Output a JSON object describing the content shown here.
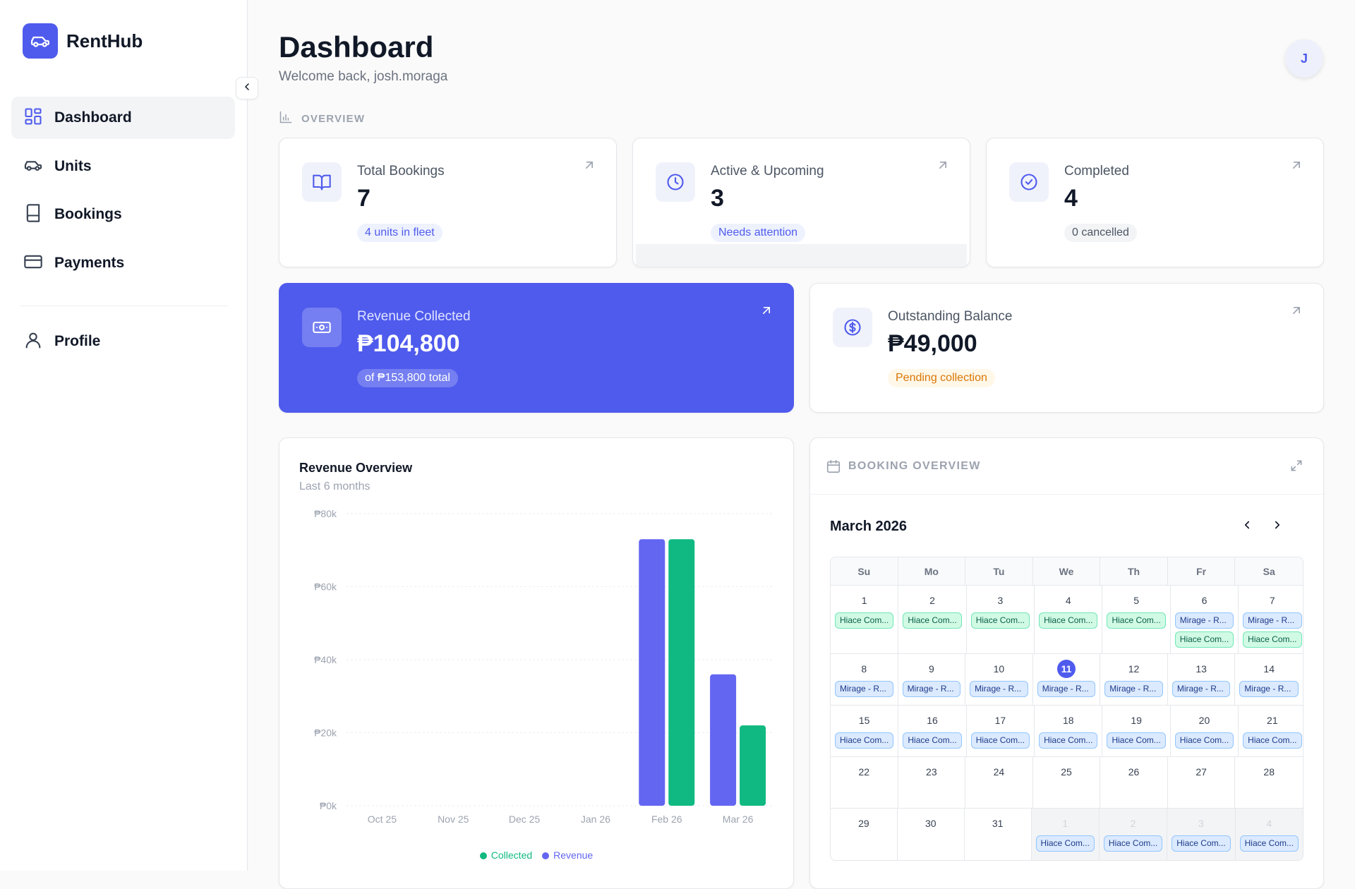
{
  "brand": {
    "name": "RentHub"
  },
  "sidebar": {
    "items": [
      {
        "label": "Dashboard",
        "icon": "dashboard-grid-icon",
        "active": true
      },
      {
        "label": "Units",
        "icon": "car-icon"
      },
      {
        "label": "Bookings",
        "icon": "book-icon"
      },
      {
        "label": "Payments",
        "icon": "credit-card-icon"
      },
      {
        "label": "Profile",
        "icon": "user-icon"
      }
    ]
  },
  "header": {
    "title": "Dashboard",
    "welcome": "Welcome back, josh.moraga",
    "avatar_initial": "J"
  },
  "overview": {
    "label": "OVERVIEW"
  },
  "stats": {
    "total_bookings": {
      "label": "Total Bookings",
      "value": "7",
      "badge": "4 units in fleet"
    },
    "active_upcoming": {
      "label": "Active & Upcoming",
      "value": "3",
      "badge": "Needs attention"
    },
    "completed": {
      "label": "Completed",
      "value": "4",
      "badge": "0 cancelled"
    },
    "revenue": {
      "label": "Revenue Collected",
      "value": "₱104,800",
      "badge": "of ₱153,800 total"
    },
    "outstanding": {
      "label": "Outstanding Balance",
      "value": "₱49,000",
      "badge": "Pending collection"
    }
  },
  "colors": {
    "accent": "#4f5bed",
    "revenue_bar": "#6366f1",
    "collected_bar": "#10b981",
    "warning": "#d97706"
  },
  "revenue_chart": {
    "title": "Revenue Overview",
    "subtitle": "Last 6 months"
  },
  "chart_data": {
    "type": "bar",
    "title": "Revenue Overview",
    "subtitle": "Last 6 months",
    "categories": [
      "Oct 25",
      "Nov 25",
      "Dec 25",
      "Jan 26",
      "Feb 26",
      "Mar 26"
    ],
    "series": [
      {
        "name": "Revenue",
        "color": "#6366f1",
        "values": [
          0,
          0,
          0,
          0,
          73000,
          36000
        ]
      },
      {
        "name": "Collected",
        "color": "#10b981",
        "values": [
          0,
          0,
          0,
          0,
          73000,
          22000
        ]
      }
    ],
    "ylim": [
      0,
      80000
    ],
    "yticks": [
      0,
      20000,
      40000,
      60000,
      80000
    ],
    "ytick_labels": [
      "₱0k",
      "₱20k",
      "₱40k",
      "₱60k",
      "₱80k"
    ],
    "legend": [
      {
        "label": "Collected",
        "color": "#10b981"
      },
      {
        "label": "Revenue",
        "color": "#6366f1"
      }
    ],
    "legend_position": "bottom",
    "grid": true
  },
  "calendar": {
    "section_label": "BOOKING OVERVIEW",
    "month": "March 2026",
    "weekdays": [
      "Su",
      "Mo",
      "Tu",
      "We",
      "Th",
      "Fr",
      "Sa"
    ],
    "weeks": [
      [
        {
          "day": "1",
          "events": [
            {
              "label": "Hiace Com...",
              "color": "green"
            }
          ]
        },
        {
          "day": "2",
          "events": [
            {
              "label": "Hiace Com...",
              "color": "green"
            }
          ]
        },
        {
          "day": "3",
          "events": [
            {
              "label": "Hiace Com...",
              "color": "green"
            }
          ]
        },
        {
          "day": "4",
          "events": [
            {
              "label": "Hiace Com...",
              "color": "green"
            }
          ]
        },
        {
          "day": "5",
          "events": [
            {
              "label": "Hiace Com...",
              "color": "green"
            }
          ]
        },
        {
          "day": "6",
          "events": [
            {
              "label": "Mirage - R...",
              "color": "blue"
            },
            {
              "label": "Hiace Com...",
              "color": "green"
            }
          ]
        },
        {
          "day": "7",
          "events": [
            {
              "label": "Mirage - R...",
              "color": "blue"
            },
            {
              "label": "Hiace Com...",
              "color": "green"
            }
          ]
        }
      ],
      [
        {
          "day": "8",
          "events": [
            {
              "label": "Mirage - R...",
              "color": "blue"
            }
          ]
        },
        {
          "day": "9",
          "events": [
            {
              "label": "Mirage - R...",
              "color": "blue"
            }
          ]
        },
        {
          "day": "10",
          "events": [
            {
              "label": "Mirage - R...",
              "color": "blue"
            }
          ]
        },
        {
          "day": "11",
          "today": true,
          "events": [
            {
              "label": "Mirage - R...",
              "color": "blue"
            }
          ]
        },
        {
          "day": "12",
          "events": [
            {
              "label": "Mirage - R...",
              "color": "blue"
            }
          ]
        },
        {
          "day": "13",
          "events": [
            {
              "label": "Mirage - R...",
              "color": "blue"
            }
          ]
        },
        {
          "day": "14",
          "events": [
            {
              "label": "Mirage - R...",
              "color": "blue"
            }
          ]
        }
      ],
      [
        {
          "day": "15",
          "events": [
            {
              "label": "Hiace Com...",
              "color": "blue"
            }
          ]
        },
        {
          "day": "16",
          "events": [
            {
              "label": "Hiace Com...",
              "color": "blue"
            }
          ]
        },
        {
          "day": "17",
          "events": [
            {
              "label": "Hiace Com...",
              "color": "blue"
            }
          ]
        },
        {
          "day": "18",
          "events": [
            {
              "label": "Hiace Com...",
              "color": "blue"
            }
          ]
        },
        {
          "day": "19",
          "events": [
            {
              "label": "Hiace Com...",
              "color": "blue"
            }
          ]
        },
        {
          "day": "20",
          "events": [
            {
              "label": "Hiace Com...",
              "color": "blue"
            }
          ]
        },
        {
          "day": "21",
          "events": [
            {
              "label": "Hiace Com...",
              "color": "blue"
            }
          ]
        }
      ],
      [
        {
          "day": "22",
          "events": []
        },
        {
          "day": "23",
          "events": []
        },
        {
          "day": "24",
          "events": []
        },
        {
          "day": "25",
          "events": []
        },
        {
          "day": "26",
          "events": []
        },
        {
          "day": "27",
          "events": []
        },
        {
          "day": "28",
          "events": []
        }
      ],
      [
        {
          "day": "29",
          "events": []
        },
        {
          "day": "30",
          "events": []
        },
        {
          "day": "31",
          "events": []
        },
        {
          "day": "1",
          "muted": true,
          "events": [
            {
              "label": "Hiace Com...",
              "color": "blue"
            }
          ]
        },
        {
          "day": "2",
          "muted": true,
          "events": [
            {
              "label": "Hiace Com...",
              "color": "blue"
            }
          ]
        },
        {
          "day": "3",
          "muted": true,
          "events": [
            {
              "label": "Hiace Com...",
              "color": "blue"
            }
          ]
        },
        {
          "day": "4",
          "muted": true,
          "events": [
            {
              "label": "Hiace Com...",
              "color": "blue"
            }
          ]
        }
      ]
    ]
  }
}
